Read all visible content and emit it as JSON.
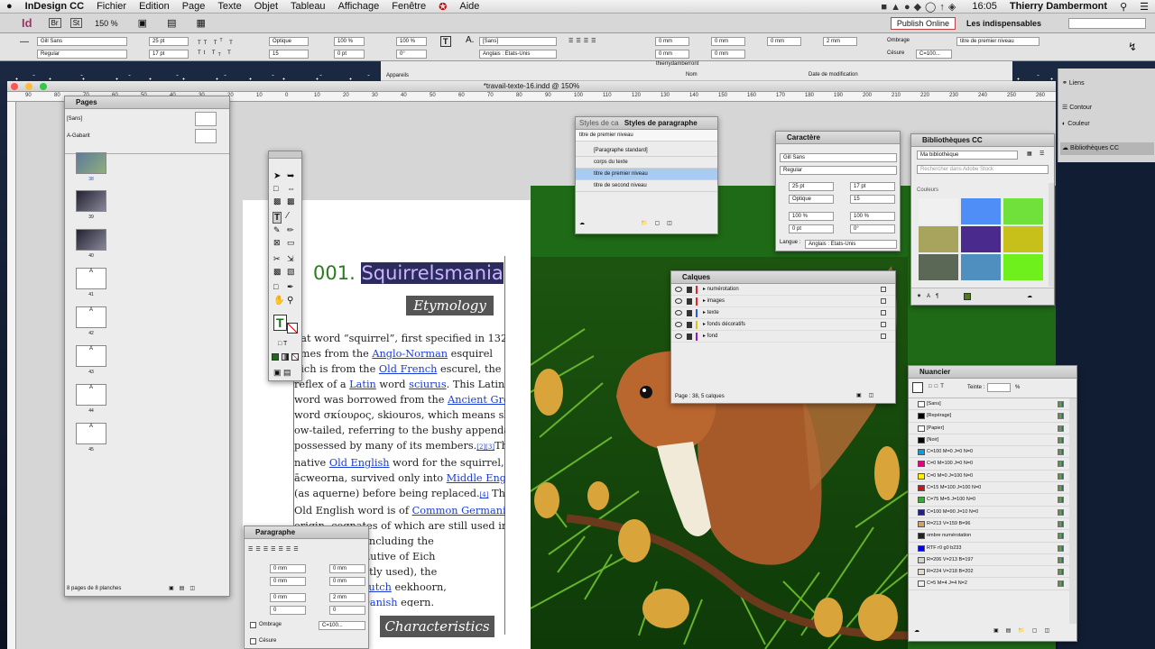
{
  "menubar": {
    "app": "InDesign CC",
    "items": [
      "Fichier",
      "Edition",
      "Page",
      "Texte",
      "Objet",
      "Tableau",
      "Affichage",
      "Fenêtre",
      "Aide"
    ],
    "time": "16:05",
    "user": "Thierry Dambermont"
  },
  "appbar": {
    "zoom": "150 %",
    "publish": "Publish Online",
    "workspace": "Les indispensables",
    "app_logo": "Id"
  },
  "control": {
    "font": "Gill Sans",
    "style": "Regular",
    "size": "25 pt",
    "leading": "17 pt",
    "kerning": "Optique",
    "tracking": "15",
    "hscale": "100 %",
    "vscale": "100 %",
    "baseline": "0 pt",
    "skew": "0°",
    "charstyle": "[Sans]",
    "language": "Anglais : Etats-Unis",
    "indent_left": "0 mm",
    "indent_right": "0 mm",
    "space_before": "0 mm",
    "space_after": "0 mm",
    "first": "0 mm",
    "last": "2 mm",
    "pstyle": "titre de premier niveau",
    "shading": "Ombrage",
    "hyphenation": "Césure",
    "color": "C=100..."
  },
  "bridge": {
    "user": "thierrydamberront",
    "col_name": "Nom",
    "col_date": "Date de modification",
    "appareils": "Appareils"
  },
  "document": {
    "title": "*travail-texte-16.indd @ 150%",
    "ruler_marks": [
      "90",
      "80",
      "70",
      "60",
      "50",
      "40",
      "30",
      "20",
      "10",
      "0",
      "10",
      "20",
      "30",
      "40",
      "50",
      "60",
      "70",
      "80",
      "90",
      "100",
      "110",
      "120",
      "130",
      "140",
      "150",
      "160",
      "170",
      "180",
      "190",
      "200",
      "210",
      "220",
      "230",
      "240",
      "250",
      "260",
      "270"
    ]
  },
  "article": {
    "heading_num": "001.",
    "heading": "Squirrelsmania",
    "etymology": "Etymology",
    "characteristics": "Characteristics",
    "lines": [
      [
        "hat word “squirrel”, first specified in 1327,"
      ],
      [
        "omes from the ",
        "Anglo-Norman",
        " esquirel"
      ],
      [
        "hich is from the ",
        "Old French",
        " escurel",
        ", the"
      ],
      [
        "reflex of a ",
        "Latin",
        " word ",
        "sciurus",
        ". This Latin"
      ],
      [
        "word was borrowed from the ",
        "Ancient Greek"
      ],
      [
        "word ",
        "σκίουρος",
        ", ",
        "skiouros",
        ", which means shad"
      ],
      [
        "ow-tailed, referring to the bushy appendage"
      ],
      [
        "possessed by many of its members.",
        "[2][3]",
        "The"
      ],
      [
        "native ",
        "Old English",
        " word for the squirrel,"
      ],
      [
        "ācweorna",
        ", survived only into ",
        "Middle English"
      ],
      [
        "(as ",
        "aquerne",
        ") before being replaced.",
        "[4]",
        " The"
      ],
      [
        "Old English word is of ",
        "Common Germanic"
      ],
      [
        "origin, ",
        "cognates",
        " of which are still used in"
      ],
      [
        "ic languages",
        ", including the"
      ],
      [
        "irnchen (diminutive of Eich"
      ],
      [
        "not as frequently used), the"
      ],
      [
        "n/ekorn",
        ", the ",
        "Dutch",
        " eekhoorn,"
      ],
      [
        "orre and the ",
        "Danish",
        " egern."
      ]
    ]
  },
  "pages_panel": {
    "title": "Pages",
    "masters": [
      "[Sans]",
      "A-Gabarit"
    ],
    "pages": [
      "38",
      "39",
      "40",
      "41",
      "42",
      "43",
      "44",
      "45"
    ],
    "footer": "8 pages de 8 planches"
  },
  "styles_panel": {
    "tabs": [
      "Styles de ca",
      "Styles de paragraphe"
    ],
    "current": "titre de premier niveau",
    "items": [
      "[Paragraphe standard]",
      "corps du texte",
      "titre de premier niveau",
      "titre de second niveau"
    ]
  },
  "char_panel": {
    "title": "Caractère",
    "font": "Gill Sans",
    "style": "Regular",
    "size": "25 pt",
    "leading": "17 pt",
    "kerning": "Optique",
    "tracking": "15",
    "vscale": "100 %",
    "hscale": "100 %",
    "baseline": "0 pt",
    "skew": "0°",
    "lang_label": "Langue :",
    "lang": "Anglais : Etats-Unis"
  },
  "layers_panel": {
    "title": "Calques",
    "layers": [
      {
        "name": "numérotation",
        "color": "#e0242a"
      },
      {
        "name": "images",
        "color": "#e0242a"
      },
      {
        "name": "texte",
        "color": "#2e55e6"
      },
      {
        "name": "fonds décoratifs",
        "color": "#d3c51c"
      },
      {
        "name": "fond",
        "color": "#8b1bd0"
      }
    ],
    "footer": "Page : 38, 5 calques"
  },
  "cc_panel": {
    "title": "Bibliothèques CC",
    "library": "Ma bibliothèque",
    "search": "Rechercher dans Adobe Stock",
    "section": "Couleurs",
    "colors": [
      "#f0f0f0",
      "#4f8ef7",
      "#6fe13a",
      "#a8a45d",
      "#4b2a8d",
      "#c7bf1a",
      "#5c6856",
      "#4f8fc0",
      "#6ef01c"
    ]
  },
  "side_dock": {
    "items": [
      "Liens",
      "Contour",
      "Couleur",
      "Bibliothèques CC"
    ]
  },
  "swatches_panel": {
    "title": "Nuancier",
    "tint_label": "Teinte :",
    "tint_unit": "%",
    "swatches": [
      {
        "name": "[Sans]",
        "color": "#ffffff"
      },
      {
        "name": "[Repérage]",
        "color": "#000000"
      },
      {
        "name": "[Papier]",
        "color": "#ffffff"
      },
      {
        "name": "[Noir]",
        "color": "#000000"
      },
      {
        "name": "C=100 M=0 J=0 N=0",
        "color": "#00a0e9"
      },
      {
        "name": "C=0 M=100 J=0 N=0",
        "color": "#e4007f"
      },
      {
        "name": "C=0 M=0 J=100 N=0",
        "color": "#fff100"
      },
      {
        "name": "C=15 M=100 J=100 N=0",
        "color": "#c8161e"
      },
      {
        "name": "C=75 M=5 J=100 N=0",
        "color": "#3aa935"
      },
      {
        "name": "C=100 M=90 J=10 N=0",
        "color": "#1d2088"
      },
      {
        "name": "R=213 V=159 B=96",
        "color": "#d59f60"
      },
      {
        "name": "ombre numérotation",
        "color": "#222222"
      },
      {
        "name": "RTF r0 g0 b233",
        "color": "#0000e9"
      },
      {
        "name": "R=206 V=213 B=197",
        "color": "#ced5c5"
      },
      {
        "name": "R=224 V=218 B=202",
        "color": "#e0daca"
      },
      {
        "name": "C=5 M=4 J=4 N=2",
        "color": "#f0efef"
      }
    ]
  },
  "para_panel": {
    "title": "Paragraphe",
    "indent": "0 mm",
    "space": "0 mm",
    "first": "2 mm",
    "lines": "0",
    "shading": "Ombrage",
    "hyphenation": "Césure",
    "color": "C=100..."
  }
}
